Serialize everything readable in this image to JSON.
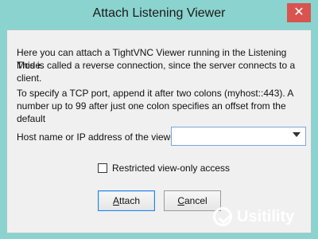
{
  "window": {
    "title": "Attach Listening Viewer",
    "close_label": "✕"
  },
  "description": {
    "line1": "Here you can attach a TightVNC Viewer running in the Listening Mode.",
    "line2": "This is called a reverse connection, since the server connects to a client.",
    "line3": "To specify a TCP port, append it after two colons (myhost::443).  A",
    "line4": "number up to 99 after just one colon specifies an offset from the default"
  },
  "host": {
    "label": "Host name or IP address of the viewer:",
    "value": ""
  },
  "restricted": {
    "label": "Restricted view-only access",
    "checked": false
  },
  "buttons": {
    "attach_label_prefix": "",
    "attach_label_underlined": "A",
    "attach_label_suffix": "ttach",
    "cancel_label_prefix": "",
    "cancel_label_underlined": "C",
    "cancel_label_suffix": "ancel"
  },
  "watermark": {
    "text": "Usitility"
  },
  "colors": {
    "title_bar": "#8bd3ce",
    "close_button": "#d9534f",
    "dialog_bg": "#f0f0f0"
  }
}
